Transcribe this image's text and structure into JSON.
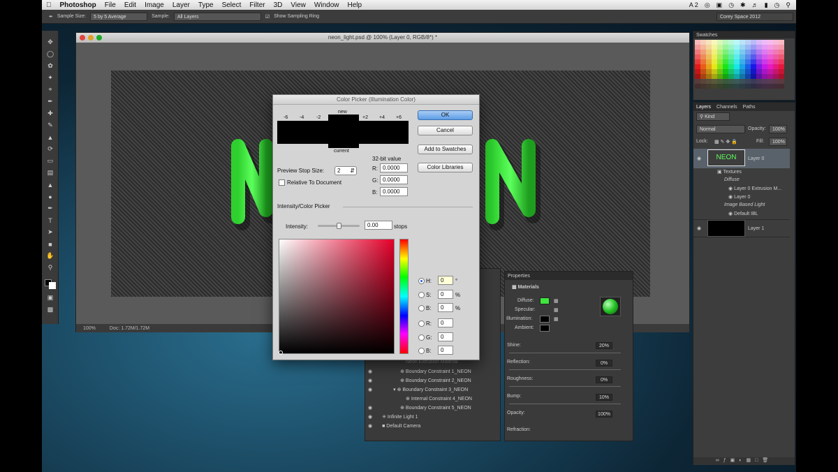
{
  "menubar": {
    "app": "Photoshop",
    "items": [
      "File",
      "Edit",
      "Image",
      "Layer",
      "Type",
      "Select",
      "Filter",
      "3D",
      "View",
      "Window",
      "Help"
    ],
    "status": [
      "2"
    ]
  },
  "options": {
    "sample_size_label": "Sample Size:",
    "sample_size_value": "5 by 5 Average",
    "sample_label": "Sample:",
    "sample_value": "All Layers",
    "sampling_ring_label": "Show Sampling Ring",
    "workspace": "Corey Space 2012"
  },
  "document": {
    "title": "neon_light.psd @ 100% (Layer 0, RGB/8*) *",
    "zoom": "100%",
    "doc_size": "Doc: 1.72M/1.72M"
  },
  "picker": {
    "title": "Color Picker (Illumination Color)",
    "new_label": "new",
    "current_label": "current",
    "stops": [
      "-6",
      "-4",
      "-2",
      "+2",
      "+4",
      "+6"
    ],
    "ok": "OK",
    "cancel": "Cancel",
    "add_swatches": "Add to Swatches",
    "color_libraries": "Color Libraries",
    "preview_stop_label": "Preview Stop Size:",
    "preview_stop_value": "2",
    "relative_label": "Relative To Document",
    "bit_label": "32-bit value",
    "bit_r_label": "R:",
    "bit_r": "0.0000",
    "bit_g_label": "G:",
    "bit_g": "0.0000",
    "bit_b_label": "B:",
    "bit_b": "0.0000",
    "section_label": "Intensity/Color Picker",
    "intensity_label": "Intensity:",
    "intensity_value": "0.00",
    "intensity_unit": "stops",
    "hsb": [
      {
        "label": "H:",
        "value": "0",
        "unit": "°"
      },
      {
        "label": "S:",
        "value": "0",
        "unit": "%"
      },
      {
        "label": "B:",
        "value": "0",
        "unit": "%"
      }
    ],
    "rgb": [
      {
        "label": "R:",
        "value": "0"
      },
      {
        "label": "G:",
        "value": "0"
      },
      {
        "label": "B:",
        "value": "0"
      }
    ]
  },
  "canvas_text": "NEON",
  "swatches": {
    "tab": "Swatches"
  },
  "layers": {
    "tabs": [
      "Layers",
      "Channels",
      "Paths"
    ],
    "kind": "Kind",
    "blend": "Normal",
    "opacity_label": "Opacity:",
    "opacity": "100%",
    "lock_label": "Lock:",
    "fill_label": "Fill:",
    "fill": "100%",
    "layer0_thumb": "NEON",
    "layer0": "Layer 0",
    "textures": "Textures",
    "diffuse": "Diffuse",
    "ext_mat": "Layer 0 Extrusion M...",
    "layer0_sub": "Layer 0",
    "ibl": "Image Based Light",
    "default_ibl": "Default IBL",
    "layer1": "Layer 1"
  },
  "properties": {
    "tab": "Properties",
    "section": "Materials",
    "diffuse": "Diffuse:",
    "specular": "Specular:",
    "illumination": "Illumination:",
    "ambient": "Ambient:",
    "shine": "Shine:",
    "shine_val": "20%",
    "reflection": "Reflection:",
    "reflection_val": "0%",
    "roughness": "Roughness:",
    "roughness_val": "0%",
    "bump": "Bump:",
    "bump_val": "10%",
    "opacity": "Opacity:",
    "opacity_val": "100%",
    "refraction": "Refraction:"
  },
  "tree": {
    "rows": [
      "Neon Extrusion Material",
      "Boundary Constraint 1_NEON",
      "Boundary Constraint 2_NEON",
      "Boundary Constraint 3_NEON",
      "Internal Constraint 4_NEON",
      "Boundary Constraint 5_NEON",
      "Infinite Light 1",
      "Default Camera"
    ]
  }
}
